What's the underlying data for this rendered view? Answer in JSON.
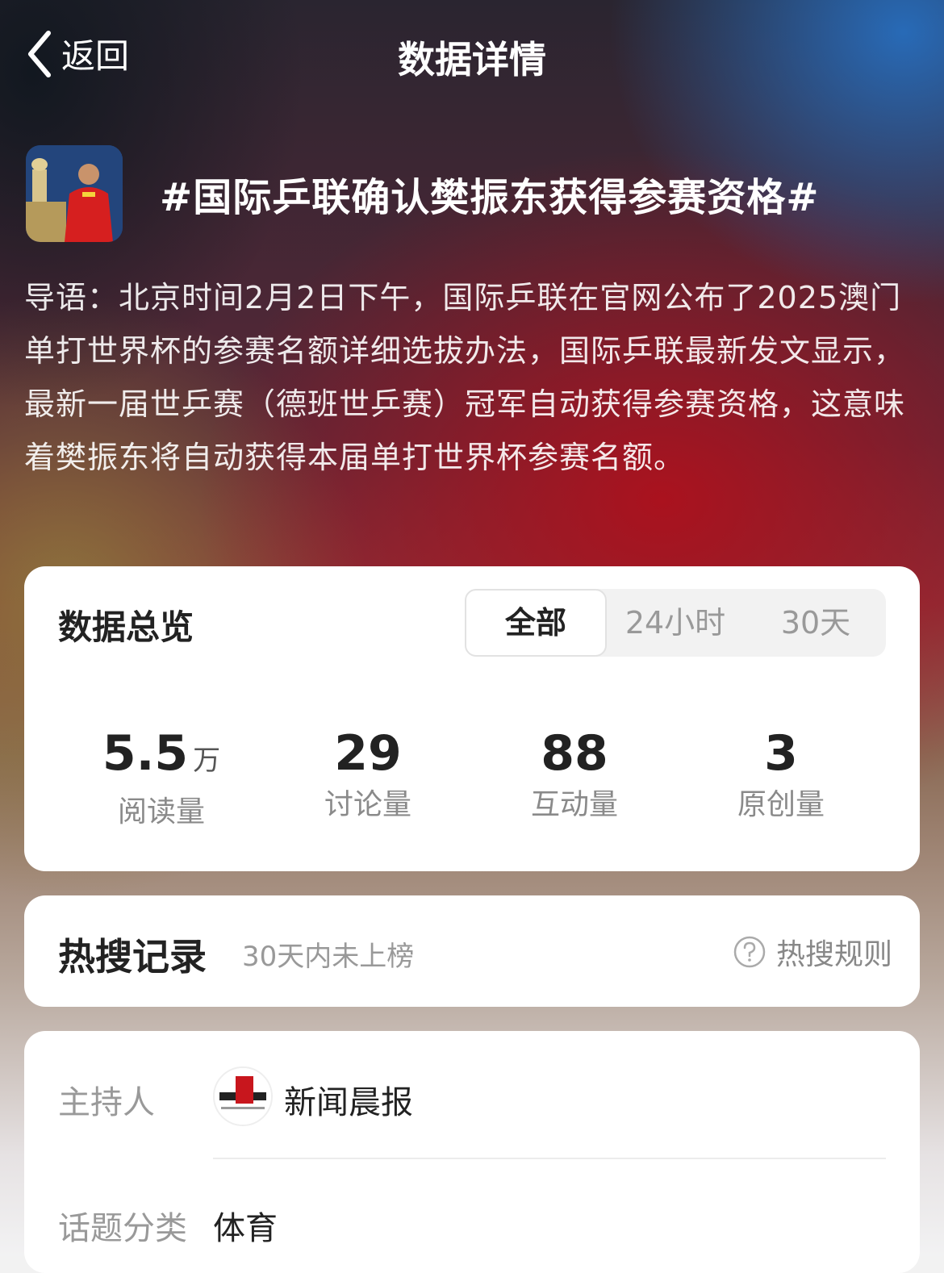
{
  "nav": {
    "back_label": "返回",
    "title": "数据详情"
  },
  "topic": {
    "title": "#国际乒联确认樊振东获得参赛资格#",
    "intro": "导语：北京时间2月2日下午，国际乒联在官网公布了2025澳门单打世界杯的参赛名额详细选拔办法，国际乒联最新发文显示，最新一届世乒赛（德班世乒赛）冠军自动获得参赛资格，这意味着樊振东将自动获得本届单打世界杯参赛名额。"
  },
  "overview": {
    "title": "数据总览",
    "tabs": [
      {
        "label": "全部",
        "active": true
      },
      {
        "label": "24小时",
        "active": false
      },
      {
        "label": "30天",
        "active": false
      }
    ],
    "stats": [
      {
        "value": "5.5",
        "unit": "万",
        "label": "阅读量"
      },
      {
        "value": "29",
        "unit": "",
        "label": "讨论量"
      },
      {
        "value": "88",
        "unit": "",
        "label": "互动量"
      },
      {
        "value": "3",
        "unit": "",
        "label": "原创量"
      }
    ]
  },
  "hot_search": {
    "title": "热搜记录",
    "subtitle": "30天内未上榜",
    "rules_label": "热搜规则",
    "rules_icon": "question-circle-icon"
  },
  "info": {
    "host_label": "主持人",
    "host_name": "新闻晨报",
    "host_logo_text": "新闻晨报",
    "category_label": "话题分类",
    "category_value": "体育"
  },
  "colors": {
    "card_bg": "#ffffff",
    "text_primary": "#222222",
    "text_secondary": "#999999"
  }
}
